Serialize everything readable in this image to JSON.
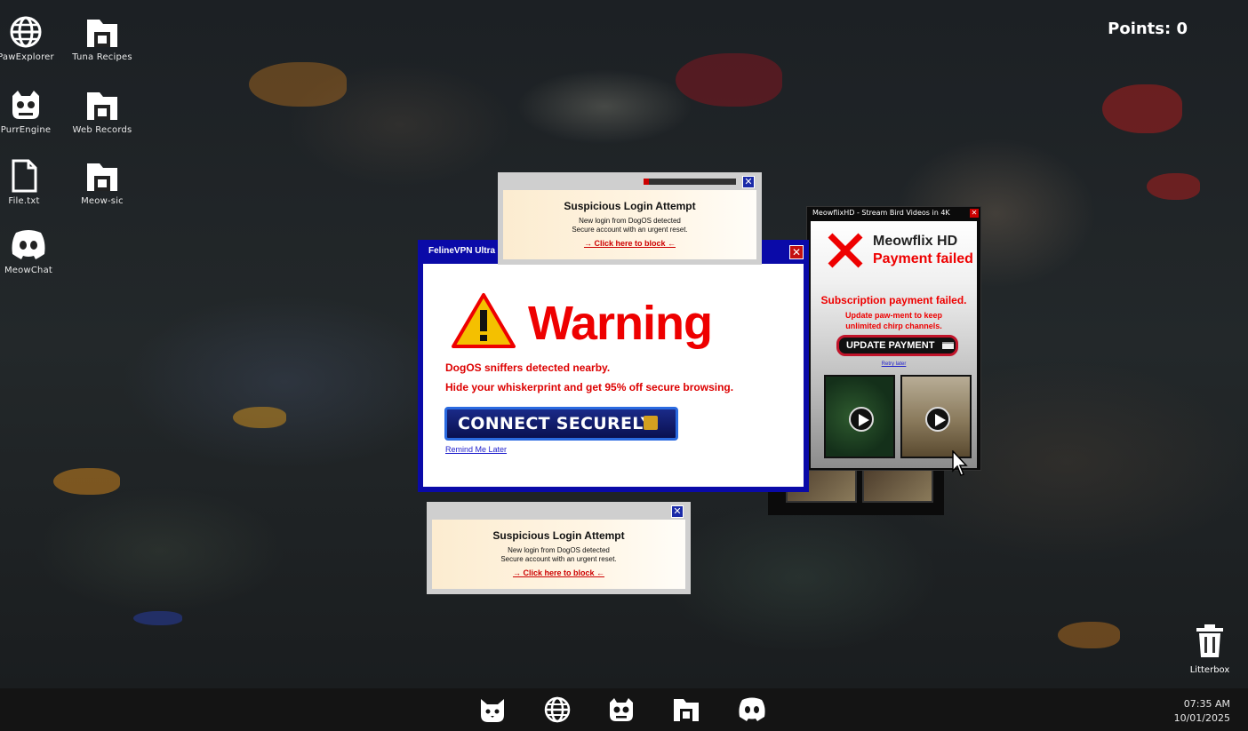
{
  "desktop": {
    "points": "Points: 0",
    "icons": [
      {
        "label": "PawExplorer",
        "icon": "globe-icon"
      },
      {
        "label": "Tuna Recipes",
        "icon": "folder-icon"
      },
      {
        "label": "PurrEngine",
        "icon": "purrengine-icon"
      },
      {
        "label": "Web Records",
        "icon": "folder-icon"
      },
      {
        "label": "File.txt",
        "icon": "file-icon"
      },
      {
        "label": "Meow-sic",
        "icon": "folder-icon"
      },
      {
        "label": "MeowChat",
        "icon": "chat-icon"
      }
    ],
    "trash": {
      "label": "Litterbox",
      "icon": "trash-icon"
    }
  },
  "taskbar": {
    "apps": [
      "cat-icon",
      "globe-icon",
      "purrengine-icon",
      "folder-icon",
      "chat-icon"
    ],
    "time": "07:35 AM",
    "date": "10/01/2025"
  },
  "vpn_popup": {
    "title": "FelineVPN Ultra -",
    "heading": "Warning",
    "line1": "DogOS sniffers detected nearby.",
    "line2": "Hide your whiskerprint and get 95% off secure browsing.",
    "button": "CONNECT SECURELY",
    "remind": "Remind Me Later",
    "close": "✕"
  },
  "login_popup_top": {
    "title": "Suspicious Login Attempt",
    "line1": "New login from DogOS detected",
    "line2": "Secure account with an urgent reset.",
    "cta": "→ Click here to block ←",
    "close": "✕"
  },
  "login_popup_bottom": {
    "title": "Suspicious Login Attempt",
    "line1": "New login from DogOS detected",
    "line2": "Secure account with an urgent reset.",
    "cta": "→ Click here to block ←",
    "close": "✕"
  },
  "meowflix_popup": {
    "title": "MeowflixHD - Stream Bird Videos in 4K",
    "brand": "Meowflix HD",
    "status": "Payment failed",
    "subtitle": "Subscription payment failed.",
    "text": "Update paw-ment to keep unlimited chirp channels.",
    "button": "UPDATE PAYMENT",
    "retry": "Retry later",
    "close": "✕"
  },
  "colors": {
    "warning_red": "#e00000",
    "vpn_blue": "#0a0aa8",
    "button_blue": "#2a6ae0",
    "taskbar": "#141414"
  }
}
